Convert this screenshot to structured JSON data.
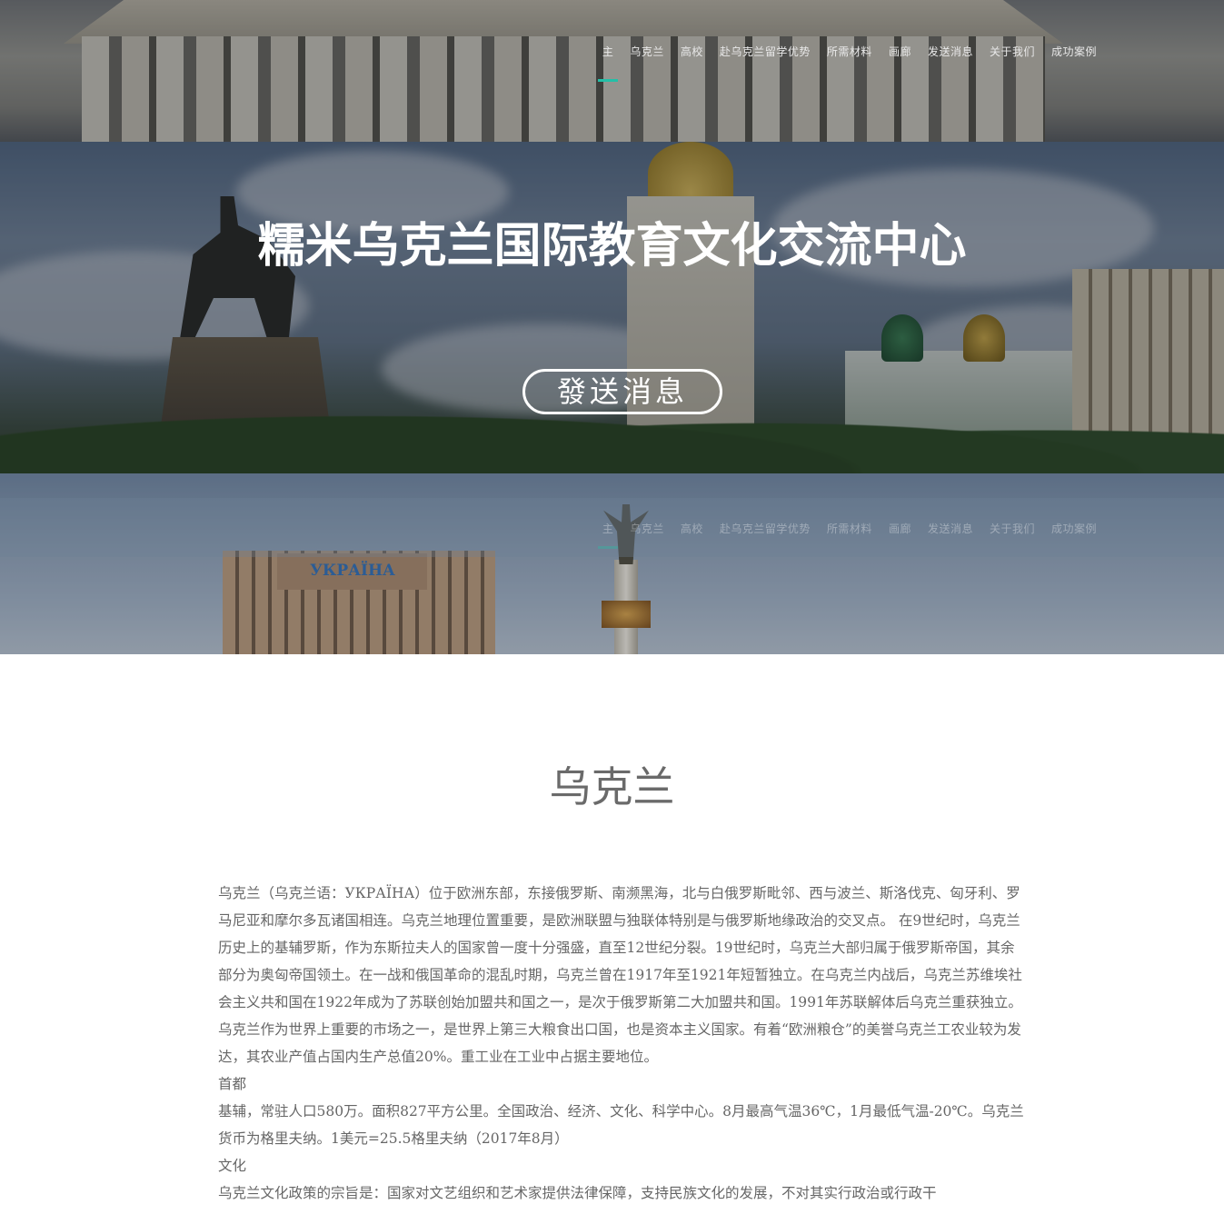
{
  "nav": {
    "items": [
      "主",
      "乌克兰",
      "高校",
      "赴乌克兰留学优势",
      "所需材料",
      "画廊",
      "发送消息",
      "关于我们",
      "成功案例"
    ],
    "active_index": 0,
    "active_color": "#23bfa7"
  },
  "hero": {
    "title": "糯米乌克兰国际教育文化交流中心",
    "button_label": "發送消息"
  },
  "band_bottom": {
    "hotel_sign": "УКРАЇНА"
  },
  "section": {
    "title": "乌克兰",
    "paragraphs": [
      "乌克兰（乌克兰语：УКРАЇНА）位于欧洲东部，东接俄罗斯、南濒黑海，北与白俄罗斯毗邻、西与波兰、斯洛伐克、匈牙利、罗马尼亚和摩尔多瓦诸国相连。乌克兰地理位置重要，是欧洲联盟与独联体特别是与俄罗斯地缘政治的交叉点。 在9世纪时，乌克兰历史上的基辅罗斯，作为东斯拉夫人的国家曾一度十分强盛，直至12世纪分裂。19世纪时，乌克兰大部归属于俄罗斯帝国，其余部分为奥匈帝国领土。在一战和俄国革命的混乱时期，乌克兰曾在1917年至1921年短暂独立。在乌克兰内战后，乌克兰苏维埃社会主义共和国在1922年成为了苏联创始加盟共和国之一，是次于俄罗斯第二大加盟共和国。1991年苏联解体后乌克兰重获独立。",
      "乌克兰作为世界上重要的市场之一，是世界上第三大粮食出口国，也是资本主义国家。有着“欧洲粮仓”的美誉乌克兰工农业较为发达，其农业产值占国内生产总值20%。重工业在工业中占据主要地位。",
      "首都",
      "基辅，常驻人口580万。面积827平方公里。全国政治、经济、文化、科学中心。8月最高气温36℃，1月最低气温-20℃。乌克兰货币为格里夫纳。1美元=25.5格里夫纳（2017年8月）",
      "文化",
      "乌克兰文化政策的宗旨是：国家对文艺组织和艺术家提供法律保障，支持民族文化的发展，不对其实行政治或行政干"
    ]
  }
}
